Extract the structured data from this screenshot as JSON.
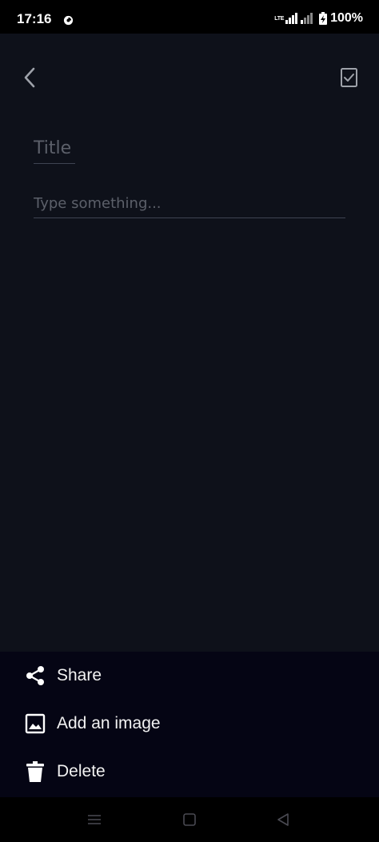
{
  "status_bar": {
    "time": "17:16",
    "network": "LTE",
    "battery": "100%"
  },
  "toolbar": {
    "back_icon": "chevron-left-icon",
    "done_icon": "checkbox-check-icon"
  },
  "note": {
    "title_placeholder": "Title",
    "title_value": "",
    "body_placeholder": "Type something...",
    "body_value": ""
  },
  "bottom_sheet": {
    "items": [
      {
        "label": "Share",
        "icon": "share-icon"
      },
      {
        "label": "Add an image",
        "icon": "image-icon"
      },
      {
        "label": "Delete",
        "icon": "trash-icon"
      }
    ]
  },
  "nav_bar": {
    "icons": [
      "recents-icon",
      "home-icon",
      "back-icon"
    ]
  },
  "colors": {
    "background": "#0e111a",
    "sheet": "#050514",
    "placeholder": "#5c606a",
    "text": "#f2f2f2"
  }
}
